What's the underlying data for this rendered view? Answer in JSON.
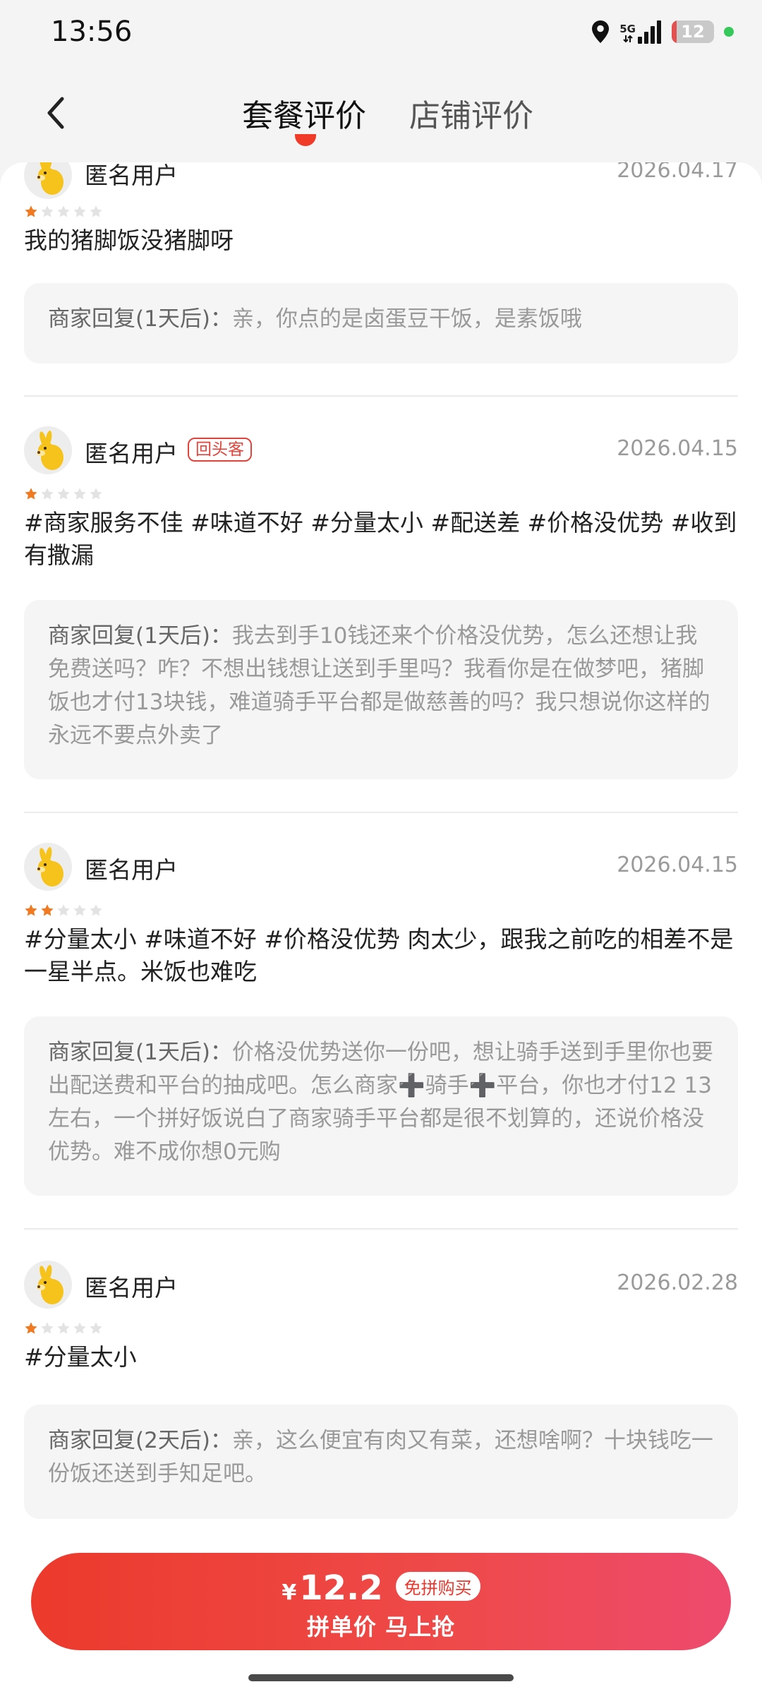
{
  "status_bar": {
    "time": "13:56",
    "network": "5G",
    "battery": "12",
    "battery_level_percent": 12
  },
  "nav": {
    "tabs": [
      {
        "label": "套餐评价",
        "active": true
      },
      {
        "label": "店铺评价",
        "active": false
      }
    ]
  },
  "reviews": [
    {
      "username": "匿名用户",
      "date": "2026.04.17",
      "rating": 1,
      "text": "我的猪脚饭没猪脚呀",
      "reply_prefix": "商家回复(1天后)：",
      "reply_text": "亲，你点的是卤蛋豆干饭，是素饭哦"
    },
    {
      "username": "匿名用户",
      "badge": "回头客",
      "date": "2026.04.15",
      "rating": 1,
      "text": "#商家服务不佳 #味道不好 #分量太小 #配送差 #价格没优势 #收到有撒漏",
      "reply_prefix": "商家回复(1天后)：",
      "reply_text": "我去到手10钱还来个价格没优势，怎么还想让我免费送吗？咋？不想出钱想让送到手里吗？我看你是在做梦吧，猪脚饭也才付13块钱，难道骑手平台都是做慈善的吗？我只想说你这样的永远不要点外卖了"
    },
    {
      "username": "匿名用户",
      "date": "2026.04.15",
      "rating": 2,
      "text": "#分量太小 #味道不好 #价格没优势 肉太少，跟我之前吃的相差不是一星半点。米饭也难吃",
      "reply_prefix": "商家回复(1天后)：",
      "reply_text": "价格没优势送你一份吧，想让骑手送到手里你也要出配送费和平台的抽成吧。怎么商家➕骑手➕平台，你也才付12 13左右，一个拼好饭说白了商家骑手平台都是很不划算的，还说价格没优势。难不成你想0元购"
    },
    {
      "username": "匿名用户",
      "date": "2026.02.28",
      "rating": 1,
      "text": "#分量太小",
      "reply_prefix": "商家回复(2天后)：",
      "reply_text": "亲，这么便宜有肉又有菜，还想啥啊？十块钱吃一份饭还送到手知足吧。"
    }
  ],
  "bottom_bar": {
    "currency": "¥",
    "price": "12.2",
    "promo_badge": "免拼购买",
    "cta": "拼单价 马上抢"
  },
  "colors": {
    "accent": "#ef3b28",
    "star_active": "#f07a22",
    "star_inactive": "#e3e3e3"
  },
  "icons": [
    "location-icon",
    "signal-icon",
    "back-icon",
    "star-icon",
    "avatar-kangaroo-icon"
  ]
}
